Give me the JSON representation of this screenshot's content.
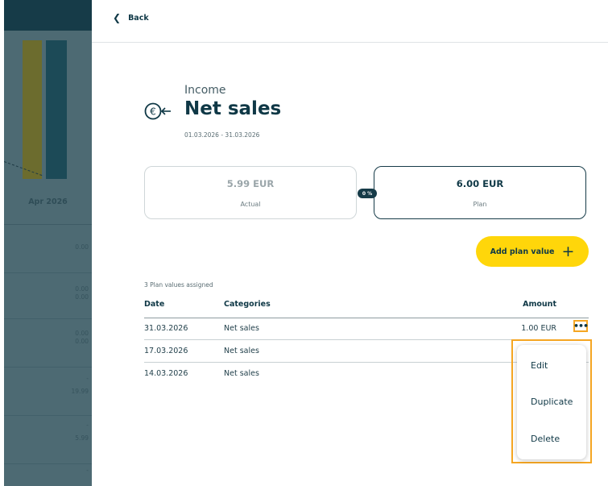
{
  "background": {
    "month_label": "Apr 2026",
    "row_values": [
      [
        "0.00"
      ],
      [
        "0.00",
        "0.00"
      ],
      [
        "0.00",
        "0.00"
      ],
      [
        "-",
        "19.99"
      ],
      [
        "-",
        "5.99"
      ],
      [
        "-"
      ]
    ]
  },
  "header": {
    "back_label": "Back"
  },
  "transaction": {
    "category": "Income",
    "title": "Net sales",
    "date_range": "01.03.2026 - 31.03.2026",
    "icon": "euro-arrow-icon"
  },
  "summary": {
    "actual_value": "5.99 EUR",
    "actual_label": "Actual",
    "plan_value": "6.00 EUR",
    "plan_label": "Plan",
    "percent": "0 %"
  },
  "add_button": {
    "label": "Add plan value",
    "icon": "plus-icon"
  },
  "table": {
    "assigned_text": "3 Plan values assigned",
    "headers": {
      "date": "Date",
      "categories": "Categories",
      "amount": "Amount"
    },
    "rows": [
      {
        "date": "31.03.2026",
        "category": "Net sales",
        "amount": "1.00 EUR"
      },
      {
        "date": "17.03.2026",
        "category": "Net sales",
        "amount": ""
      },
      {
        "date": "14.03.2026",
        "category": "Net sales",
        "amount": ""
      }
    ],
    "more_icon": "•••"
  },
  "context_menu": {
    "items": [
      "Edit",
      "Duplicate",
      "Delete"
    ]
  },
  "colors": {
    "accent": "#ffd60a",
    "primary": "#0f3846",
    "highlight": "#f5a623",
    "overlay": "#4d6a73"
  }
}
